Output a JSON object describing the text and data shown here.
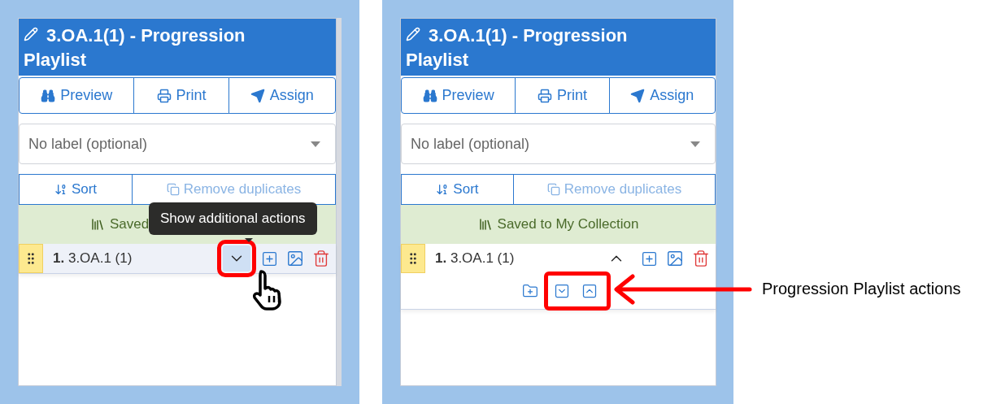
{
  "panels": [
    {
      "title": "3.OA.1(1) - Progression Playlist",
      "buttons": [
        {
          "kind": "preview",
          "label": "Preview"
        },
        {
          "kind": "print",
          "label": "Print"
        },
        {
          "kind": "assign",
          "label": "Assign"
        }
      ],
      "label_select": {
        "placeholder": "No label (optional)"
      },
      "tools": [
        {
          "kind": "sort",
          "label": "Sort",
          "disabled": false
        },
        {
          "kind": "duplicates",
          "label": "Remove duplicates",
          "disabled": true
        }
      ],
      "status": "Saved",
      "items": [
        {
          "number": "1.",
          "name": "3.OA.1 (1)",
          "expanded": false,
          "hovered": true,
          "toggle_highlighted": true
        }
      ],
      "tooltip": "Show additional actions",
      "cursor": true
    },
    {
      "title": "3.OA.1(1) - Progression Playlist",
      "buttons": [
        {
          "kind": "preview",
          "label": "Preview"
        },
        {
          "kind": "print",
          "label": "Print"
        },
        {
          "kind": "assign",
          "label": "Assign"
        }
      ],
      "label_select": {
        "placeholder": "No label (optional)"
      },
      "tools": [
        {
          "kind": "sort",
          "label": "Sort",
          "disabled": false
        },
        {
          "kind": "duplicates",
          "label": "Remove duplicates",
          "disabled": true
        }
      ],
      "status": "Saved to My Collection",
      "items": [
        {
          "number": "1.",
          "name": "3.OA.1 (1)",
          "expanded": true,
          "hovered": false,
          "actions_highlighted": true
        }
      ]
    }
  ],
  "callout": "Progression Playlist actions"
}
